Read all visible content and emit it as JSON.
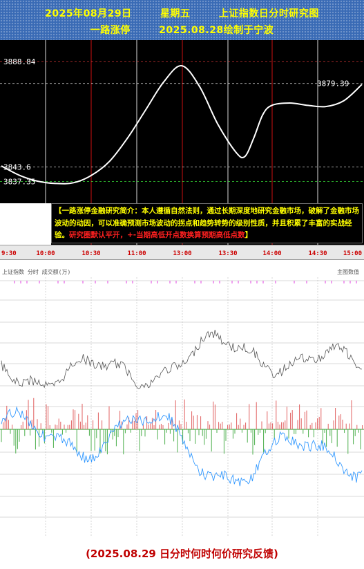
{
  "header": {
    "date": "2025年08月29日",
    "weekday": "星期五",
    "title": "上证指数日分时研究图",
    "author": "一路涨停",
    "made_note": "2025.08.28绘制于宁波"
  },
  "intro": {
    "part1": "【一路涨停金融研究简介：本人遵循自然法则，通过长期深度地研究金融市场，破解了金融市场波动的动因，可以准确预测市场波动的拐点和趋势转势的级别性质，并且积累了丰富的实战经验。",
    "part2": "研究圈默认平开，+-当期高低开点数换算预期高低点数",
    "close": "】"
  },
  "lower_panel": {
    "label_left": "上证指数  分时 成交额(万)",
    "label_right": "主图数值"
  },
  "footer": {
    "text": "(2025.08.29 日分时何时何价研究反馈)"
  },
  "chart_data": {
    "type": "line",
    "x_ticks": [
      "9:30",
      "10:00",
      "10:30",
      "11:00",
      "13:00",
      "13:30",
      "14:00",
      "14:30",
      "15:00"
    ],
    "y_labels": [
      {
        "label": "3888.84",
        "value": 3888.84,
        "color": "#ff4040"
      },
      {
        "label": "3879.39",
        "value": 3879.39,
        "color": "#ffffff"
      },
      {
        "label": "3843.6",
        "value": 3843.6,
        "color": "#ffffff"
      },
      {
        "label": "3837.35",
        "value": 3837.35,
        "color": "#40ff40"
      }
    ],
    "ylim": [
      3828,
      3898
    ],
    "series": [
      {
        "color": "#ffffff",
        "x": [
          0,
          0.05,
          0.1,
          0.15,
          0.2,
          0.25,
          0.3,
          0.35,
          0.4,
          0.45,
          0.5,
          0.55,
          0.6,
          0.65,
          0.675,
          0.7,
          0.725,
          0.75,
          0.8,
          0.85,
          0.9,
          0.95,
          1.0
        ],
        "y": [
          3844,
          3840,
          3837.5,
          3836.5,
          3836.8,
          3840,
          3846,
          3856,
          3868,
          3880,
          3887,
          3878,
          3862,
          3850,
          3848,
          3856,
          3866,
          3870,
          3871,
          3870,
          3869.5,
          3872,
          3879
        ]
      }
    ]
  }
}
